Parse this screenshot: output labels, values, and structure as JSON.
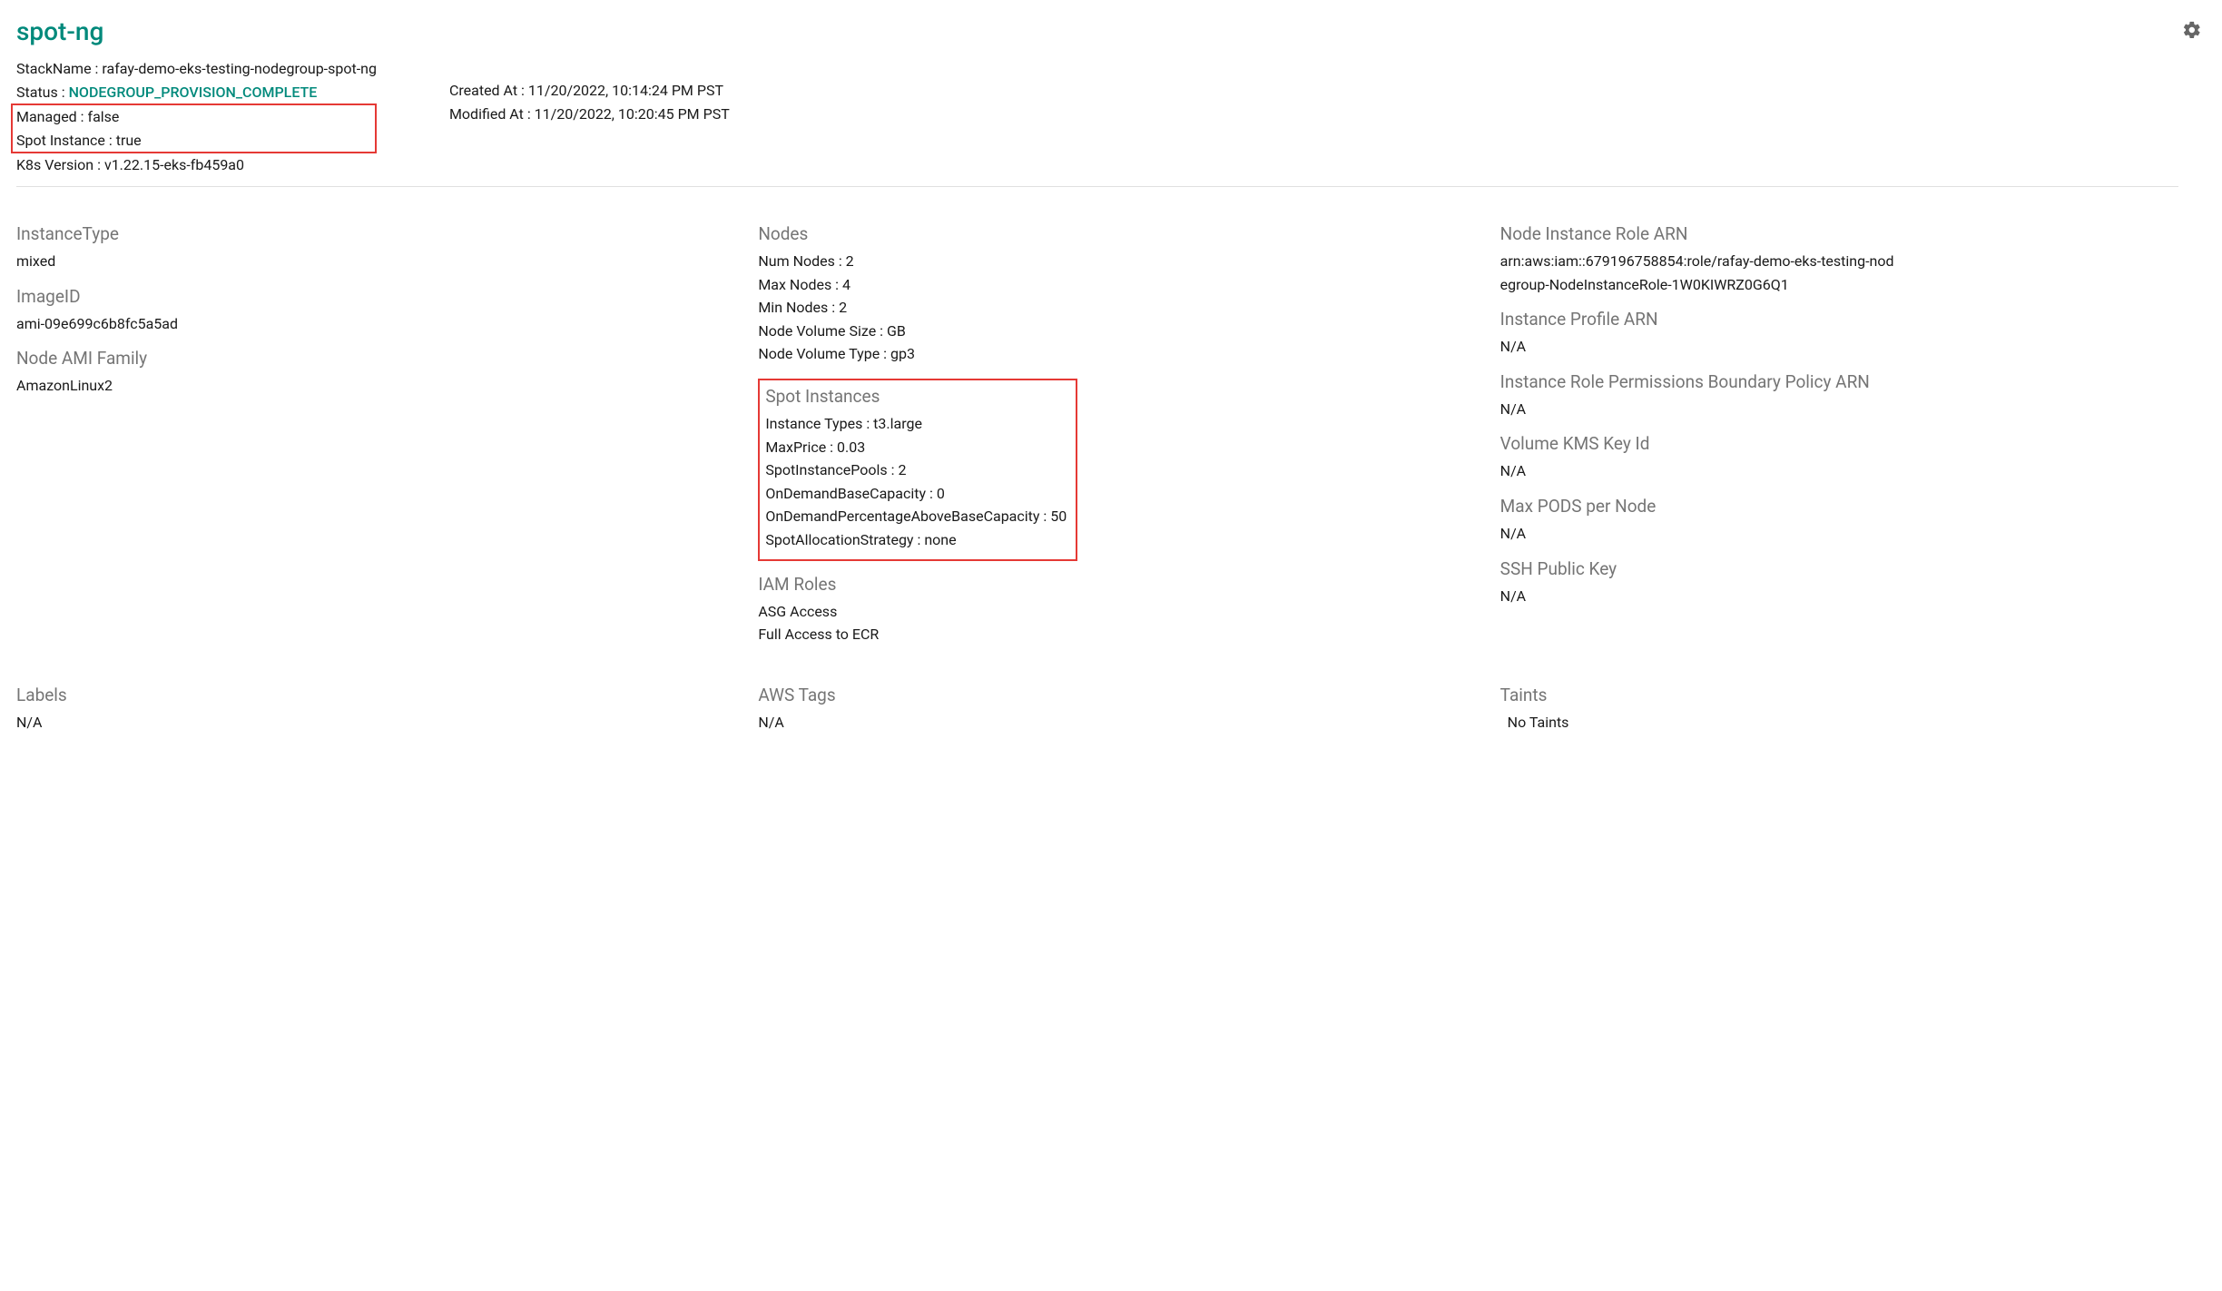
{
  "title": "spot-ng",
  "header": {
    "stackNameLabel": "StackName :",
    "stackName": "rafay-demo-eks-testing-nodegroup-spot-ng",
    "statusLabel": "Status :",
    "status": "NODEGROUP_PROVISION_COMPLETE",
    "managedLabel": "Managed :",
    "managed": "false",
    "spotLabel": "Spot Instance :",
    "spot": "true",
    "k8sLabel": "K8s Version :",
    "k8s": "v1.22.15-eks-fb459a0",
    "createdLabel": "Created At :",
    "created": "11/20/2022, 10:14:24 PM PST",
    "modifiedLabel": "Modified At :",
    "modified": "11/20/2022, 10:20:45 PM PST"
  },
  "col1": {
    "instanceTypeTitle": "InstanceType",
    "instanceType": "mixed",
    "imageIdTitle": "ImageID",
    "imageId": "ami-09e699c6b8fc5a5ad",
    "amiFamilyTitle": "Node AMI Family",
    "amiFamily": "AmazonLinux2"
  },
  "col2": {
    "nodesTitle": "Nodes",
    "numNodes": "Num Nodes : 2",
    "maxNodes": "Max Nodes : 4",
    "minNodes": "Min Nodes : 2",
    "volSize": "Node Volume Size :   GB",
    "volType": "Node Volume Type :  gp3",
    "spotTitle": "Spot Instances",
    "spotTypes": "Instance Types :  t3.large",
    "maxPrice": "MaxPrice :  0.03",
    "spotPools": "SpotInstancePools :  2",
    "onDemandBase": "OnDemandBaseCapacity :  0",
    "onDemandPct": "OnDemandPercentageAboveBaseCapacity :  50",
    "spotStrategy": "SpotAllocationStrategy :  none",
    "iamTitle": "IAM Roles",
    "iam1": "ASG Access",
    "iam2": "Full Access to ECR"
  },
  "col3": {
    "nodeRoleArnTitle": "Node Instance Role ARN",
    "nodeRoleArn": "arn:aws:iam::679196758854:role/rafay-demo-eks-testing-nodegroup-NodeInstanceRole-1W0KIWRZ0G6Q1",
    "instanceProfileTitle": "Instance Profile ARN",
    "instanceProfile": "N/A",
    "permBoundaryTitle": "Instance Role Permissions Boundary Policy ARN",
    "permBoundary": "N/A",
    "kmsTitle": "Volume KMS Key Id",
    "kms": "N/A",
    "maxPodsTitle": "Max PODS per Node",
    "maxPods": "N/A",
    "sshTitle": "SSH Public Key",
    "ssh": "N/A"
  },
  "bottom": {
    "labelsTitle": "Labels",
    "labels": "N/A",
    "awsTagsTitle": "AWS Tags",
    "awsTags": "N/A",
    "taintsTitle": "Taints",
    "taints": "No Taints"
  }
}
